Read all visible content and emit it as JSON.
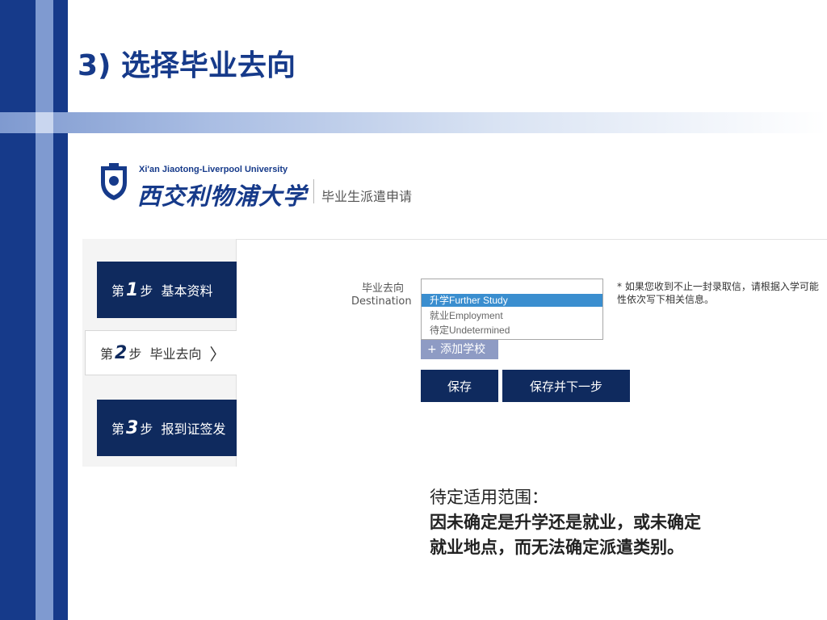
{
  "slide": {
    "title": "3) 选择毕业去向"
  },
  "logo": {
    "english_name": "Xi'an Jiaotong-Liverpool University",
    "chinese_name": "西交利物浦大学",
    "subtitle": "毕业生派遣申请"
  },
  "steps": [
    {
      "prefix": "第",
      "number": "1",
      "suffix": "步",
      "label": "基本资料"
    },
    {
      "prefix": "第",
      "number": "2",
      "suffix": "步",
      "label": "毕业去向",
      "chevron": "〉"
    },
    {
      "prefix": "第",
      "number": "3",
      "suffix": "步",
      "label": "报到证签发"
    }
  ],
  "form": {
    "label_cn": "毕业去向",
    "label_en": "Destination",
    "dropdown_options": [
      "升学Further Study",
      "就业Employment",
      "待定Undetermined"
    ],
    "highlighted_option": "升学Further Study",
    "add_school_label": "+ 添加学校",
    "save_label": "保存",
    "save_next_label": "保存并下一步",
    "note": "* 如果您收到不止一封录取信，请根据入学可能性依次写下相关信息。"
  },
  "explanation": {
    "heading": "待定适用范围：",
    "line1": "因未确定是升学还是就业，或未确定",
    "line2": "就业地点，而无法确定派遣类别。"
  },
  "colors": {
    "brand_navy": "#0f2a5e",
    "slide_blue": "#163a8a",
    "highlight": "#3a8ecf"
  }
}
